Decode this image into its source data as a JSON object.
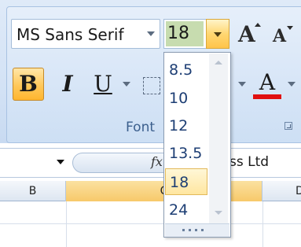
{
  "font_group": {
    "font_name": "MS Sans Serif",
    "font_size": "18",
    "grow_font": "A",
    "shrink_font": "A",
    "bold_label": "B",
    "italic_label": "I",
    "underline_label": "U",
    "font_color_label": "A",
    "group_label": "Font"
  },
  "formula_bar": {
    "fx_label": "fx",
    "visible_text": "ss Ltd"
  },
  "grid": {
    "columns": [
      "B",
      "C",
      "D"
    ]
  },
  "font_size_dropdown": {
    "items": [
      "8.5",
      "10",
      "12",
      "13.5",
      "18",
      "24"
    ],
    "selected": "18"
  },
  "colors": {
    "font_color": "#e01010",
    "hover_gold": "#ffc85a",
    "ribbon_label": "#3b5f8d"
  }
}
